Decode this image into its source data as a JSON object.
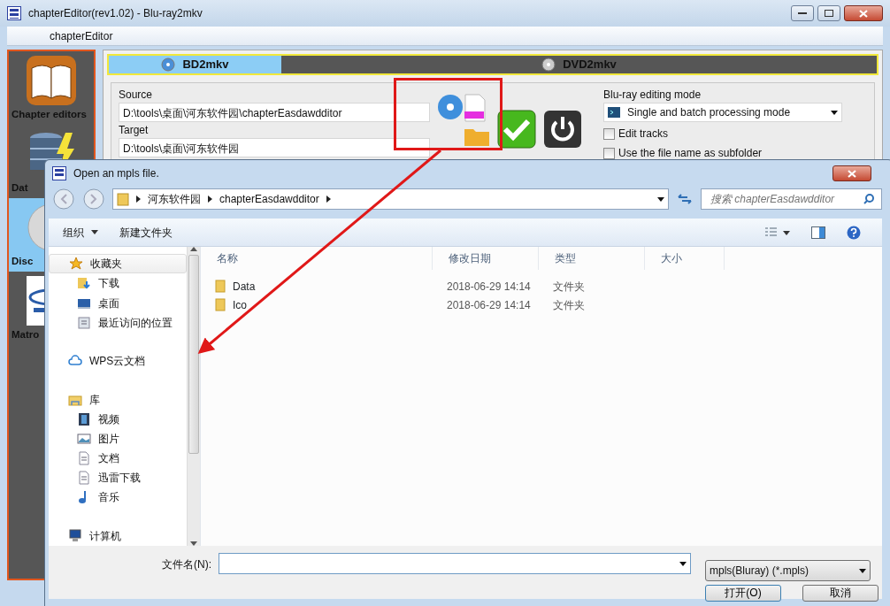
{
  "window": {
    "title": "chapterEditor(rev1.02) - Blu-ray2mkv",
    "subtitle": "chapterEditor"
  },
  "sidebar": {
    "items": [
      {
        "label": "Chapter editors",
        "kind": "book",
        "selected": false
      },
      {
        "label": "Dat",
        "kind": "database",
        "selected": false
      },
      {
        "label": "Disc",
        "kind": "disc",
        "selected": true
      },
      {
        "label": "Matro",
        "kind": "matroska",
        "selected": false
      }
    ]
  },
  "tabs": [
    {
      "label": "BD2mkv",
      "selected": true
    },
    {
      "label": "DVD2mkv",
      "selected": false
    }
  ],
  "source": {
    "label": "Source",
    "value": "D:\\tools\\桌面\\河东软件园\\chapterEasdawdditor"
  },
  "target": {
    "label": "Target",
    "value": "D:\\tools\\桌面\\河东软件园"
  },
  "mode": {
    "label": "Blu-ray editing mode",
    "value": "Single and batch processing mode"
  },
  "options": [
    {
      "label": "Edit tracks",
      "checked": false
    },
    {
      "label": "Use the file name as subfolder",
      "checked": false
    }
  ],
  "dialog": {
    "title": "Open an mpls file.",
    "breadcrumb": [
      "河东软件园",
      "chapterEasdawdditor"
    ],
    "search": {
      "placeholder": "搜索 chapterEasdawdditor"
    },
    "toolbar": [
      {
        "label": "组织",
        "dropdown": true
      },
      {
        "label": "新建文件夹",
        "dropdown": false
      }
    ],
    "nav": [
      {
        "label": "收藏夹",
        "kind": "star",
        "selected": true,
        "children": [
          {
            "label": "下载",
            "kind": "download",
            "selected": false
          },
          {
            "label": "桌面",
            "kind": "desktop",
            "selected": false
          },
          {
            "label": "最近访问的位置",
            "kind": "recent",
            "selected": false
          }
        ]
      },
      {
        "label": "WPS云文档",
        "kind": "cloud",
        "selected": false
      },
      {
        "label": "库",
        "kind": "library",
        "selected": false,
        "children": [
          {
            "label": "视频",
            "kind": "video",
            "selected": false
          },
          {
            "label": "图片",
            "kind": "picture",
            "selected": false
          },
          {
            "label": "文档",
            "kind": "document",
            "selected": false
          },
          {
            "label": "迅雷下载",
            "kind": "document",
            "selected": false
          },
          {
            "label": "音乐",
            "kind": "music",
            "selected": false
          }
        ]
      },
      {
        "label": "计算机",
        "kind": "computer",
        "selected": false
      }
    ],
    "columns": [
      "名称",
      "修改日期",
      "类型",
      "大小"
    ],
    "rows": [
      {
        "name": "Data",
        "date": "2018-06-29 14:14",
        "type": "文件夹"
      },
      {
        "name": "Ico",
        "date": "2018-06-29 14:14",
        "type": "文件夹"
      }
    ],
    "file_name": {
      "label": "文件名(N):"
    },
    "filter": "mpls(Bluray) (*.mpls)",
    "buttons": [
      "打开(O)",
      "取消"
    ]
  }
}
